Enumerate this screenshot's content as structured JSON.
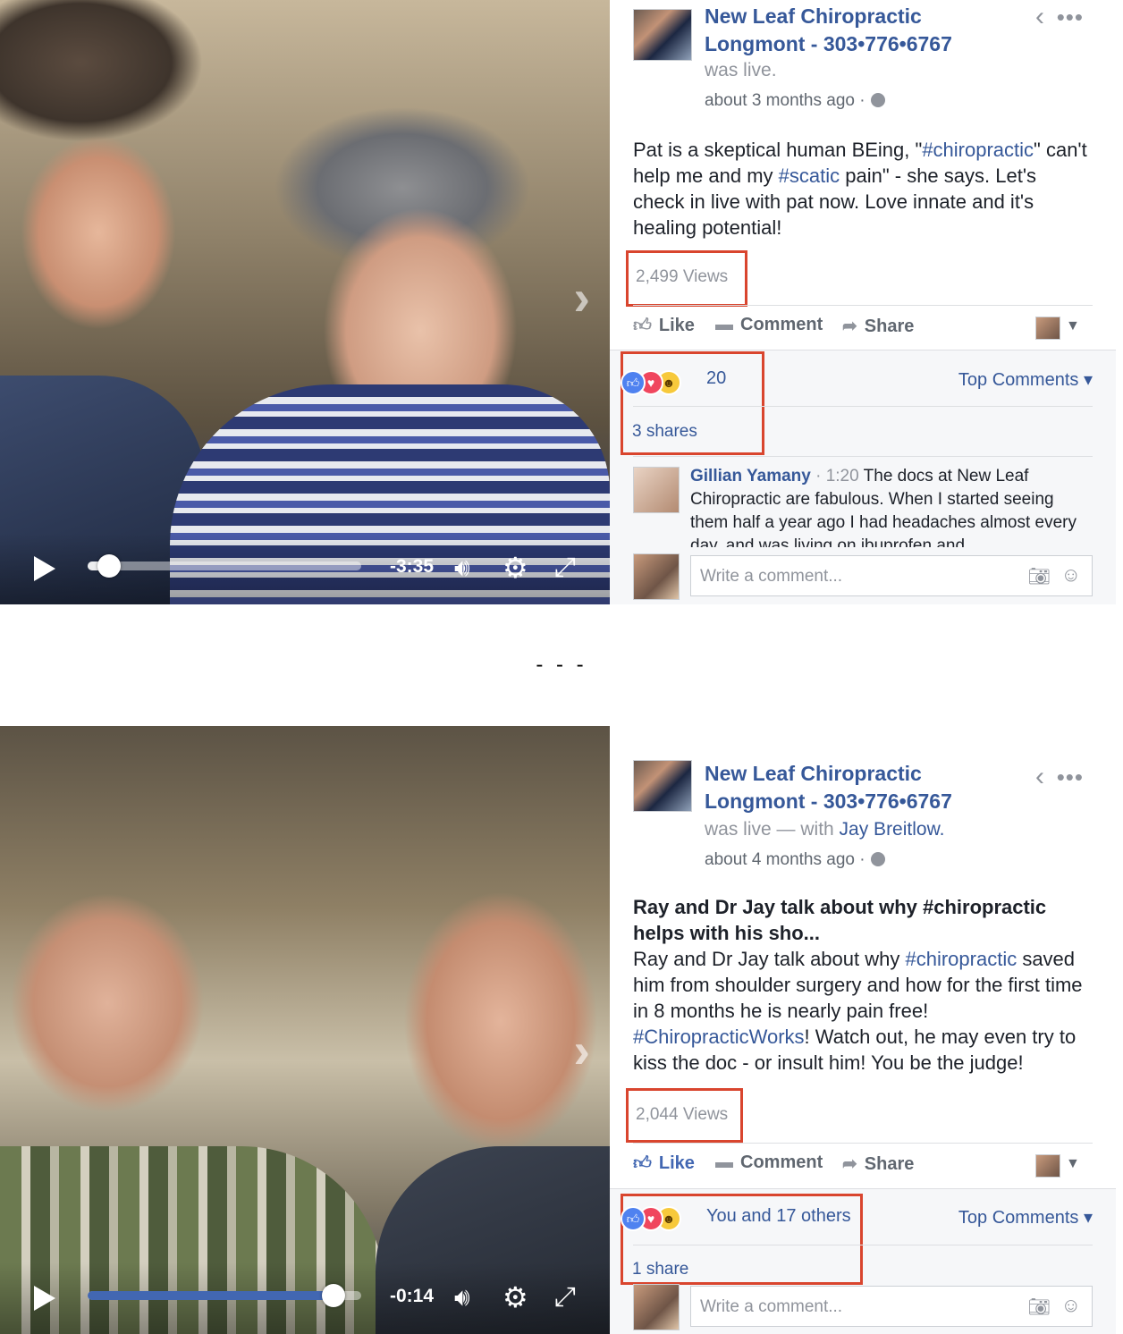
{
  "separator": "- - -",
  "posts": [
    {
      "page_name": "New Leaf Chiropractic Longmont - 303•776•6767",
      "was_live": "was live.",
      "tagged": "",
      "time_ago": "about 3 months ago ·",
      "message_bold": "",
      "message_parts": [
        "Pat is a skeptical human BEing, \"",
        "#chiropractic",
        "\" can't help me and my ",
        "#scatic",
        " pain\" - she says. Let's check in live with pat now. Love innate and it's healing potential!"
      ],
      "views": "2,499 Views",
      "actions": {
        "like": "Like",
        "comment": "Comment",
        "share": "Share"
      },
      "reaction_count": "20",
      "top_comments": "Top Comments ▾",
      "shares": "3 shares",
      "comment": {
        "author": "Gillian Yamany",
        "time": "· 1:20",
        "text": "The docs at New Leaf Chiropractic are fabulous. When I started seeing them half a year ago I had headaches almost every day, and was living on ibuprofen and"
      },
      "compose_placeholder": "Write a comment...",
      "video": {
        "time": "-3:35",
        "progress": 0.08
      }
    },
    {
      "page_name": "New Leaf Chiropractic Longmont - 303•776•6767",
      "was_live": "was live — with ",
      "tagged": "Jay Breitlow.",
      "time_ago": "about 4 months ago ·",
      "message_bold": "Ray and Dr Jay talk about why #chiropractic helps with his sho...",
      "message_parts": [
        "Ray and Dr Jay talk about why ",
        "#chiropractic",
        " saved him from shoulder surgery and how for the first time in 8 months he is nearly pain free! ",
        "#ChiropracticWorks",
        "! Watch out, he may even try to kiss the doc - or insult him! You be the judge!"
      ],
      "views": "2,044 Views",
      "actions": {
        "like": "Like",
        "comment": "Comment",
        "share": "Share"
      },
      "reaction_count": "You and 17 others",
      "top_comments": "Top Comments ▾",
      "shares": "1 share",
      "compose_placeholder": "Write a comment...",
      "video": {
        "time": "-0:14",
        "progress": 0.9
      }
    }
  ],
  "icons": [
    "play-icon",
    "volume-icon",
    "gear-icon",
    "expand-icon",
    "back-icon",
    "more-icon",
    "globe-icon",
    "like-icon",
    "comment-icon",
    "share-icon",
    "camera-icon",
    "smiley-icon"
  ],
  "colors": {
    "link": "#365899",
    "highlight_box": "#d9452e",
    "progress_blue": "#4267b2"
  }
}
